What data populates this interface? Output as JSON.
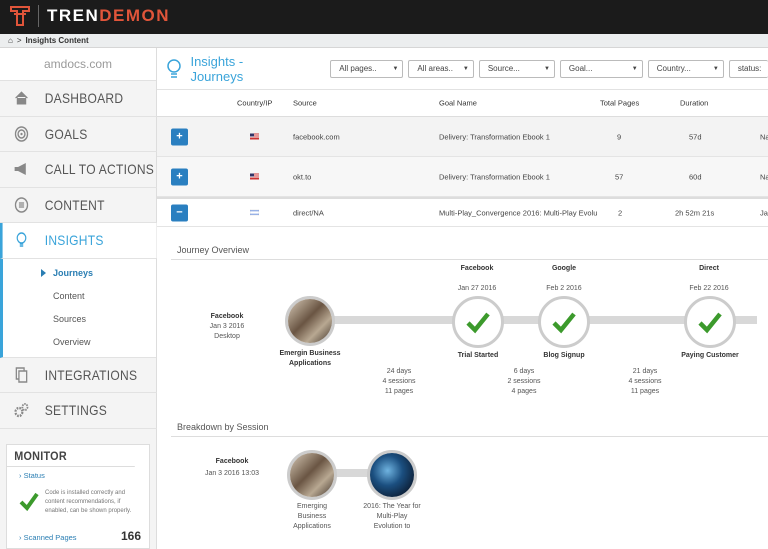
{
  "app": {
    "brand_left": "TREN",
    "brand_right": "DEMON"
  },
  "breadcrumb": {
    "current": "Insights Content",
    "sep": ">"
  },
  "sidebar": {
    "site": "amdocs.com",
    "items": [
      {
        "label": "DASHBOARD",
        "icon": "home-icon"
      },
      {
        "label": "GOALS",
        "icon": "target-icon"
      },
      {
        "label": "CALL TO ACTIONS",
        "icon": "megaphone-icon"
      },
      {
        "label": "CONTENT",
        "icon": "list-icon"
      },
      {
        "label": "INSIGHTS",
        "icon": "bulb-icon"
      },
      {
        "label": "INTEGRATIONS",
        "icon": "copy-icon"
      },
      {
        "label": "SETTINGS",
        "icon": "gears-icon"
      }
    ],
    "sub": [
      "Journeys",
      "Content",
      "Sources",
      "Overview"
    ]
  },
  "monitor": {
    "title": "MONITOR",
    "status": "Status",
    "desc": "Code is installed correctly and content recommendations, if enabled, can be shown properly.",
    "scanned": "Scanned Pages",
    "scanned_count": "166"
  },
  "header": {
    "title": "Insights - Journeys",
    "filters": [
      "All pages..",
      "All areas..",
      "Source...",
      "Goal...",
      "Country...",
      "status:"
    ]
  },
  "table": {
    "headers": [
      "Country/IP",
      "Source",
      "Goal Name",
      "Total Pages",
      "Duration"
    ],
    "rows": [
      {
        "source": "facebook.com",
        "goal": "Delivery: Transformation Ebook 1",
        "pages": "9",
        "duration": "57d",
        "extra": "Na",
        "btn": "+"
      },
      {
        "source": "okt.to",
        "goal": "Delivery: Transformation Ebook 1",
        "pages": "57",
        "duration": "60d",
        "extra": "Na",
        "btn": "+"
      },
      {
        "source": "direct/NA",
        "goal": "Multi-Play_Convergence 2016: Multi-Play Evolu",
        "pages": "2",
        "duration": "2h 52m 21s",
        "extra": "Ja",
        "btn": "−"
      }
    ]
  },
  "overview": {
    "title": "Journey Overview",
    "start": {
      "source": "Facebook",
      "date": "Jan 3 2016",
      "device": "Desktop",
      "label": "Emergin Business Applications"
    },
    "steps": [
      {
        "source": "Facebook",
        "date": "Jan 27 2016",
        "label": "Trial Started"
      },
      {
        "source": "Google",
        "date": "Feb 2 2016",
        "label": "Blog Signup"
      },
      {
        "source": "Direct",
        "date": "Feb 22 2016",
        "label": "Paying Customer"
      }
    ],
    "gaps": [
      {
        "days": "24 days",
        "sessions": "4 sessions",
        "pages": "11 pages"
      },
      {
        "days": "6 days",
        "sessions": "2 sessions",
        "pages": "4 pages"
      },
      {
        "days": "21 days",
        "sessions": "4 sessions",
        "pages": "11 pages"
      }
    ]
  },
  "breakdown": {
    "title": "Breakdown by Session",
    "source": "Facebook",
    "date": "Jan 3 2016 13:03",
    "pages": [
      "Emerging Business Applications",
      "2016: The Year for Multi-Play Evolution to"
    ]
  }
}
